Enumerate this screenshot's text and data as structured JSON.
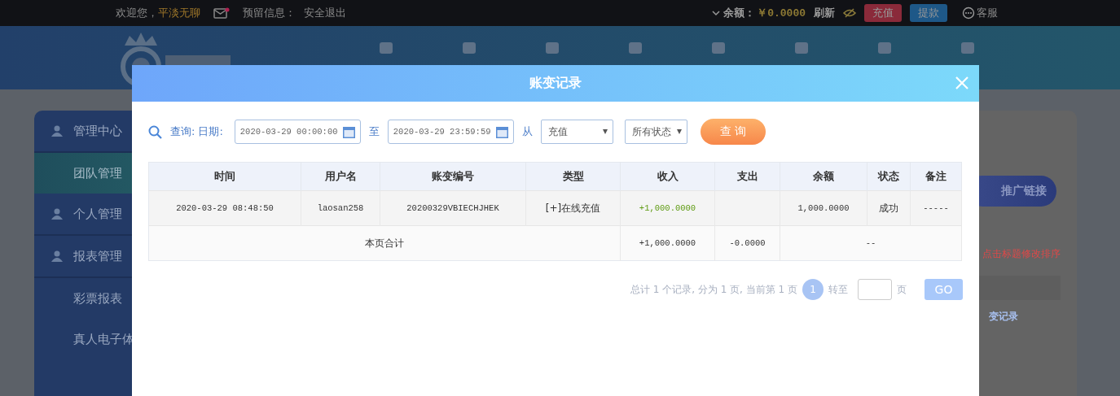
{
  "top_bar": {
    "welcome": "欢迎您，",
    "username": "平淡无聊",
    "mail_unread": true,
    "reserved_info": "预留信息：",
    "logout": "安全退出",
    "balance_label": "余额：",
    "balance": "￥0.0000",
    "refresh": "刷新",
    "deposit": "充值",
    "withdraw": "提款",
    "service": "客服"
  },
  "sidebar": {
    "items": [
      {
        "kind": "group",
        "label": "管理中心",
        "selected": false
      },
      {
        "kind": "item",
        "label": "团队管理",
        "selected": true
      },
      {
        "kind": "group",
        "label": "个人管理",
        "selected": false
      },
      {
        "kind": "group",
        "label": "报表管理",
        "selected": false
      },
      {
        "kind": "item",
        "label": "彩票报表",
        "selected": false
      },
      {
        "kind": "item",
        "label": "真人电子体",
        "selected": false
      }
    ]
  },
  "right_panel": {
    "promo_button": "推广链接",
    "hint": "点击标题修改排序",
    "link": "变记录"
  },
  "modal": {
    "title": "账变记录",
    "filters": {
      "query_label": "查询:",
      "date_label": "日期:",
      "start": "2020-03-29 00:00:00",
      "to": "至",
      "end": "2020-03-29 23:59:59",
      "from": "从",
      "type": "充值",
      "status": "所有状态",
      "search_button": "查 询"
    },
    "table": {
      "columns": [
        "时间",
        "用户名",
        "账变编号",
        "类型",
        "收入",
        "支出",
        "余额",
        "状态",
        "备注"
      ],
      "rows": [
        {
          "cells": [
            "2020-03-29 08:48:50",
            "laosan258",
            "20200329VBIECHJHEK",
            "[+]在线充值",
            "+1,000.0000",
            "",
            "1,000.0000",
            "成功",
            "-----"
          ]
        }
      ],
      "summary": {
        "label": "本页合计",
        "income": "+1,000.0000",
        "expense": "-0.0000",
        "rest": "--"
      }
    },
    "pagination": {
      "summary": "总计 1 个记录, 分为 1 页, 当前第 1 页",
      "pages": [
        {
          "label": "1",
          "selected": true
        }
      ],
      "goto": "转至",
      "suffix": "页",
      "go": "GO"
    }
  }
}
